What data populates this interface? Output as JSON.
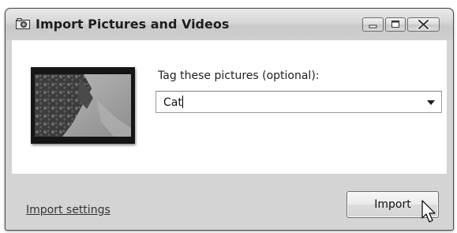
{
  "window": {
    "title": "Import Pictures and Videos"
  },
  "main": {
    "tag_label": "Tag these pictures (optional):",
    "tag_value": "Cat"
  },
  "footer": {
    "settings_link": "Import settings",
    "import_label": "Import"
  },
  "icons": {
    "app": "camera-icon",
    "minimize": "minimize-icon",
    "maximize": "maximize-icon",
    "close": "close-icon",
    "dropdown": "chevron-down-icon",
    "cursor": "mouse-pointer-icon"
  }
}
